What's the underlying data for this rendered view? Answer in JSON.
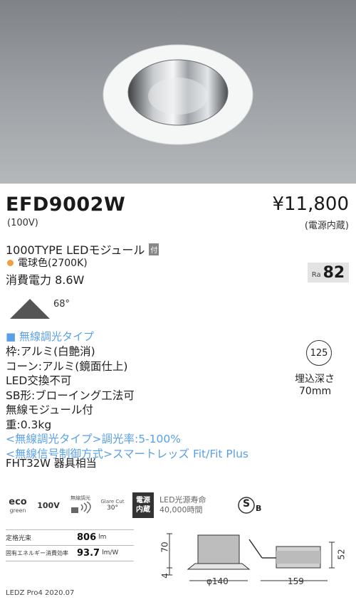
{
  "product": {
    "model": "EFD9002W",
    "voltage": "(100V)",
    "price": "¥11,800",
    "price_note": "(電源内蔵)",
    "type_line": "1000TYPE LEDモジュール",
    "type_tag": "付",
    "color_temp": "電球色(2700K)",
    "power": "消費電力 8.6W",
    "ra_label": "Ra",
    "ra_value": "82",
    "beam_angle": "68°"
  },
  "specs": {
    "category": "■ 無線調光タイプ",
    "lines": [
      "枠:アルミ(白艶消)",
      "コーン:アルミ(鏡面仕上)",
      "LED交換不可",
      "SB形:ブローイング工法可",
      "無線モジュール付",
      "重:0.3kg"
    ],
    "blue_lines": [
      "<無線調光タイプ>調光率:5-100%",
      "<無線信号制御方式>スマートレッズ Fit/Fit Plus"
    ],
    "equivalent": "FHT32W 器具相当"
  },
  "cutout": {
    "size": "125",
    "depth_label": "埋込深さ",
    "depth_value": "70mm"
  },
  "badges": {
    "eco_top": "eco",
    "eco_bottom": "green",
    "voltage": "100V",
    "wireless_label": "無線調光",
    "glare_label": "Glare Cut",
    "glare_value": "30°",
    "power_box_line1": "電源",
    "power_box_line2": "内蔵",
    "life_line1": "LED光源寿命",
    "life_line2": "40,000時間",
    "cert": "S",
    "cert_sub": "B"
  },
  "performance": {
    "rows": [
      {
        "label": "定格光束",
        "value": "806",
        "unit": "lm"
      },
      {
        "label": "固有エネルギー消費効率",
        "value": "93.7",
        "unit": "lm/W"
      }
    ]
  },
  "dimensions": {
    "height": "70",
    "bottom": "4",
    "diameter": "φ140",
    "side": "52",
    "length": "159"
  },
  "footer": "LEDZ Pro4 2020.07",
  "colors": {
    "accent_blue": "#5aa0e6",
    "orange_dot": "#f0a040",
    "ceiling_gray": "#9a9ea2"
  }
}
